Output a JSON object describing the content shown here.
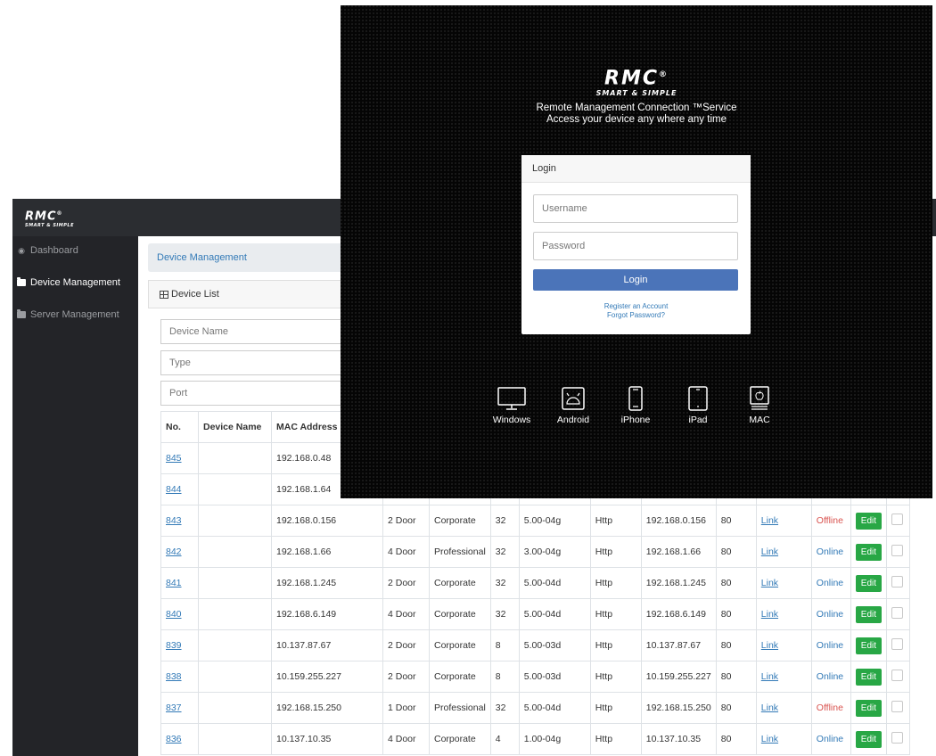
{
  "admin": {
    "logo": {
      "main": "RMC",
      "sub": "SMART & SIMPLE",
      "mark": "®"
    },
    "sidebar": {
      "items": [
        {
          "label": "Dashboard",
          "icon": "dashboard-icon"
        },
        {
          "label": "Device Management",
          "icon": "folder-icon",
          "active": true
        },
        {
          "label": "Server Management",
          "icon": "folder-icon"
        }
      ]
    },
    "breadcrumb": "Device Management",
    "card_title": "Device List",
    "filters": {
      "device_name": "Device Name",
      "type": "Type",
      "port": "Port"
    },
    "table": {
      "headers": [
        "No.",
        "Device Name",
        "MAC Address"
      ],
      "link_label": "Link",
      "edit_label": "Edit",
      "rows": [
        {
          "no": "845",
          "name": "",
          "mac": "192.168.0.48",
          "doors": "",
          "edition": "",
          "ch": "",
          "ver": "",
          "proto": "",
          "ip": "",
          "port": "",
          "status": "",
          "status_type": ""
        },
        {
          "no": "844",
          "name": "",
          "mac": "192.168.1.64",
          "doors": "",
          "edition": "",
          "ch": "",
          "ver": "",
          "proto": "",
          "ip": "",
          "port": "",
          "status": "",
          "status_type": ""
        },
        {
          "no": "843",
          "name": "",
          "mac": "192.168.0.156",
          "doors": "2 Door",
          "edition": "Corporate",
          "ch": "32",
          "ver": "5.00-04g",
          "proto": "Http",
          "ip": "192.168.0.156",
          "port": "80",
          "status": "Offline",
          "status_type": "offline"
        },
        {
          "no": "842",
          "name": "",
          "mac": "192.168.1.66",
          "doors": "4 Door",
          "edition": "Professional",
          "ch": "32",
          "ver": "3.00-04g",
          "proto": "Http",
          "ip": "192.168.1.66",
          "port": "80",
          "status": "Online",
          "status_type": "online"
        },
        {
          "no": "841",
          "name": "",
          "mac": "192.168.1.245",
          "doors": "2 Door",
          "edition": "Corporate",
          "ch": "32",
          "ver": "5.00-04d",
          "proto": "Http",
          "ip": "192.168.1.245",
          "port": "80",
          "status": "Online",
          "status_type": "online"
        },
        {
          "no": "840",
          "name": "",
          "mac": "192.168.6.149",
          "doors": "4 Door",
          "edition": "Corporate",
          "ch": "32",
          "ver": "5.00-04d",
          "proto": "Http",
          "ip": "192.168.6.149",
          "port": "80",
          "status": "Online",
          "status_type": "online"
        },
        {
          "no": "839",
          "name": "",
          "mac": "10.137.87.67",
          "doors": "2 Door",
          "edition": "Corporate",
          "ch": "8",
          "ver": "5.00-03d",
          "proto": "Http",
          "ip": "10.137.87.67",
          "port": "80",
          "status": "Online",
          "status_type": "online"
        },
        {
          "no": "838",
          "name": "",
          "mac": "10.159.255.227",
          "doors": "2 Door",
          "edition": "Corporate",
          "ch": "8",
          "ver": "5.00-03d",
          "proto": "Http",
          "ip": "10.159.255.227",
          "port": "80",
          "status": "Online",
          "status_type": "online"
        },
        {
          "no": "837",
          "name": "",
          "mac": "192.168.15.250",
          "doors": "1 Door",
          "edition": "Professional",
          "ch": "32",
          "ver": "5.00-04d",
          "proto": "Http",
          "ip": "192.168.15.250",
          "port": "80",
          "status": "Offline",
          "status_type": "offline"
        },
        {
          "no": "836",
          "name": "",
          "mac": "10.137.10.35",
          "doors": "4 Door",
          "edition": "Corporate",
          "ch": "4",
          "ver": "1.00-04g",
          "proto": "Http",
          "ip": "10.137.10.35",
          "port": "80",
          "status": "Online",
          "status_type": "online"
        }
      ]
    }
  },
  "login": {
    "logo": {
      "main": "RMC",
      "sub": "SMART & SIMPLE",
      "mark": "®"
    },
    "tagline1": "Remote Management Connection ™Service",
    "tagline2": "Access your device any where any time",
    "card_title": "Login",
    "username_placeholder": "Username",
    "password_placeholder": "Password",
    "button": "Login",
    "register_link": "Register an Account",
    "forgot_link": "Forgot Password?",
    "platforms": [
      {
        "label": "Windows",
        "icon": "monitor-icon"
      },
      {
        "label": "Android",
        "icon": "android-icon"
      },
      {
        "label": "iPhone",
        "icon": "phone-icon"
      },
      {
        "label": "iPad",
        "icon": "tablet-icon"
      },
      {
        "label": "MAC",
        "icon": "apple-icon"
      }
    ]
  },
  "colors": {
    "topbar": "#2b2d31",
    "sidebar": "#232428",
    "link": "#337ab7",
    "online": "#337ab7",
    "offline": "#d9534f",
    "edit": "#28a745",
    "login_button": "#4b74b9"
  }
}
